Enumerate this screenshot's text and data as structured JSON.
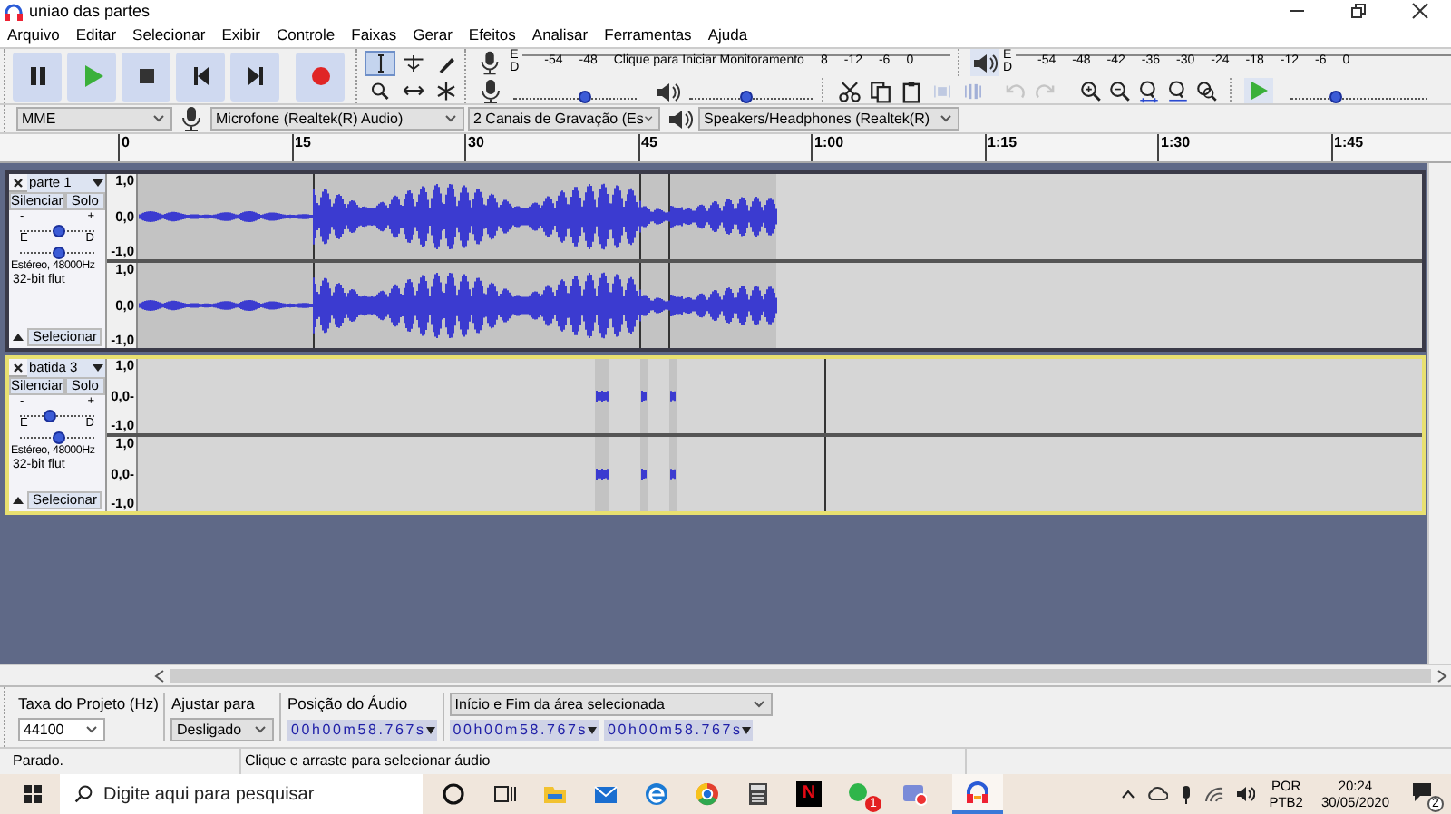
{
  "window": {
    "title": "uniao das partes"
  },
  "menu": [
    "Arquivo",
    "Editar",
    "Selecionar",
    "Exibir",
    "Controle",
    "Faixas",
    "Gerar",
    "Efeitos",
    "Analisar",
    "Ferramentas",
    "Ajuda"
  ],
  "transport": [
    {
      "kind": "pause"
    },
    {
      "kind": "play"
    },
    {
      "kind": "stop"
    },
    {
      "kind": "skip_start"
    },
    {
      "kind": "skip_end"
    },
    {
      "kind": "record"
    }
  ],
  "tools": [
    {
      "kind": "select",
      "selected": true
    },
    {
      "kind": "envelope",
      "selected": false
    },
    {
      "kind": "draw",
      "selected": false
    },
    {
      "kind": "zoom",
      "selected": false
    },
    {
      "kind": "timeshift",
      "selected": false
    },
    {
      "kind": "multi",
      "selected": false
    }
  ],
  "record_meter": {
    "channels": [
      "E",
      "D"
    ],
    "ticks": [
      "-54",
      "-48"
    ],
    "prompt": "Clique para Iniciar Monitoramento",
    "ticks_after": [
      "8",
      "-12",
      "-6",
      "0"
    ]
  },
  "playback_meter": {
    "channels": [
      "E",
      "D"
    ],
    "ticks": [
      "-54",
      "-48",
      "-42",
      "-36",
      "-30",
      "-24",
      "-18",
      "-12",
      "-6",
      "0"
    ]
  },
  "recording_volume": {
    "level": 0.58
  },
  "playback_volume": {
    "level": 0.45
  },
  "edit_tools": [
    {
      "kind": "cut",
      "disabled": false
    },
    {
      "kind": "copy",
      "disabled": false
    },
    {
      "kind": "paste",
      "disabled": false
    },
    {
      "kind": "trim",
      "disabled": true
    },
    {
      "kind": "silence",
      "disabled": true
    },
    {
      "kind": "undo",
      "disabled": true
    },
    {
      "kind": "redo",
      "disabled": true
    }
  ],
  "zoom_tools": [
    {
      "kind": "zoom_in"
    },
    {
      "kind": "zoom_out"
    },
    {
      "kind": "fit_selection"
    },
    {
      "kind": "fit_project"
    },
    {
      "kind": "zoom_toggle"
    }
  ],
  "play_at_speed": {
    "level": 0.33
  },
  "devices": {
    "host": "MME",
    "recording": "Microfone (Realtek(R) Audio)",
    "channels": "2 Canais de  Gravação (Es",
    "playback": "Speakers/Headphones (Realtek(R)"
  },
  "ruler": [
    "0",
    "15",
    "30",
    "45",
    "1:00",
    "1:15",
    "1:30",
    "1:45"
  ],
  "tracks": [
    {
      "kind": "speech",
      "name": "parte 1",
      "focused": false,
      "mute": "Silenciar",
      "solo": "Solo",
      "gain": {
        "minus": "-",
        "plus": "+",
        "level": 0.5
      },
      "pan": {
        "left": "E",
        "right": "D",
        "level": 0.5
      },
      "format": "Estéreo, 48000Hz",
      "bit_depth": "32-bit flut",
      "select": "Selecionar",
      "channels": [
        {
          "scale": [
            "1,0",
            "0,0",
            "-1,0"
          ]
        },
        {
          "scale": [
            "1,0",
            "0,0",
            "-1,0"
          ]
        }
      ]
    },
    {
      "kind": "beats",
      "name": "batida 3",
      "focused": true,
      "mute": "Silenciar",
      "solo": "Solo",
      "gain": {
        "minus": "-",
        "plus": "+",
        "level": 0.4
      },
      "pan": {
        "left": "E",
        "right": "D",
        "level": 0.5
      },
      "format": "Estéreo, 48000Hz",
      "bit_depth": "32-bit flut",
      "select": "Selecionar",
      "channels": [
        {
          "scale": [
            "1,0",
            "0,0-",
            "-1,0"
          ]
        },
        {
          "scale": [
            "1,0",
            "0,0-",
            "-1,0"
          ]
        }
      ]
    }
  ],
  "selection_toolbar": {
    "rate_label": "Taxa do Projeto (Hz)",
    "rate": "44100",
    "snap_label": "Ajustar para",
    "snap": "Desligado",
    "position_label": "Posição do Áudio",
    "position": "00h00m58.767s",
    "selection_label": "Início e Fim da área selecionada",
    "start": "00h00m58.767s",
    "end": "00h00m58.767s"
  },
  "status": {
    "state": "Parado.",
    "hint": "Clique e arraste para selecionar áudio"
  },
  "taskbar": {
    "search_placeholder": "Digite aqui para pesquisar",
    "letter_tile": "N",
    "chat_badge": "1",
    "language": "POR",
    "layout": "PTB2",
    "time": "20:24",
    "date": "30/05/2020",
    "notifications": "2"
  }
}
